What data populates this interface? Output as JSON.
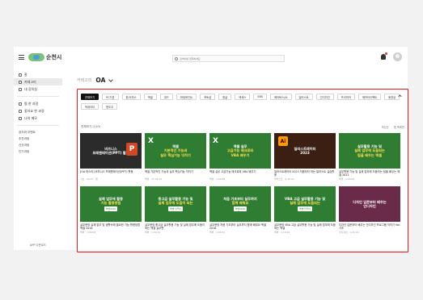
{
  "brand": {
    "logo_text": "순천시"
  },
  "search": {
    "placeholder": "검색어를 입력하세요"
  },
  "sidebar": {
    "items": [
      {
        "label": "홈",
        "active": false
      },
      {
        "label": "카테고리",
        "active": true
      },
      {
        "label": "내 강의실",
        "active": false
      }
    ],
    "items2": [
      {
        "label": "찜 한 과정"
      },
      {
        "label": "좋아요 한 과정"
      },
      {
        "label": "나의 메모"
      }
    ],
    "plain": [
      "공지와 이벤트",
      "추천과정",
      "신규과정",
      "인기과정"
    ],
    "footer": "APP 다운로드"
  },
  "breadcrumb": {
    "label": "카테고리",
    "current": "OA"
  },
  "chips": [
    "전체보기",
    "PC기본",
    "한/오피스",
    "엑셀",
    "워드",
    "파워포인트",
    "포토샵",
    "한글",
    "엑세스",
    "SNS",
    "메타버스/AI",
    "일러스트",
    "인디자인",
    "프리미어",
    "에프터이펙트",
    "동영상",
    "빅데이터",
    "윈도우"
  ],
  "list": {
    "count": "전체보기 (210)",
    "sort_label": "최신순",
    "filter_label": "찜 목록만"
  },
  "cards": [
    {
      "thumb": "pptx",
      "lines": [
        "비즈니스",
        "프레젠테이션(PPT) 활용"
      ],
      "title": "[OA 마스터] 비즈니스 프레젠테이션(PPT) 활용",
      "meta": "기초 · 04:37 · 찜"
    },
    {
      "thumb": "green",
      "lines": [
        "엑셀",
        "기본적인 기능과",
        "실무 핵심기능 익히기"
      ],
      "title": "엑셀 기본적인 기능과 실무 핵심기능 익히기",
      "meta": "엑셀 · 17:36:19"
    },
    {
      "thumb": "green",
      "lines": [
        "엑셀 실무",
        "고급기능 매크로와",
        "VBA 배우기"
      ],
      "title": "엑셀 실무 고급기능 매크로와 VBA 배우기",
      "meta": "엑셀 · 1:00:48"
    },
    {
      "thumb": "illustrator",
      "lines": [
        "일러스트레이터",
        "2023"
      ],
      "title": "일러스트레이터 2023 처음부터 하는 일러스트 실습활용",
      "meta": "일러스트 · 1:10:22"
    },
    {
      "thumb": "green",
      "lines": [
        "실무활용 기능 및",
        "실제 업무에 도움되는",
        "팁을 배우는 엑셀"
      ],
      "title": "실무활용 기능 및 실제 업무에 도움되는 팁을 배우는 엑셀 2021",
      "meta": "엑셀 · 1:40:09"
    },
    {
      "thumb": "green",
      "lines": [
        "실제 업무에 활용",
        "기능 활용방법",
        "엑셀2016"
      ],
      "title": "실무현장 실제 업무 및 생활속에 필요한 기능 활용방법 엑셀 2016",
      "meta": "엑셀 · 1:40:04"
    },
    {
      "thumb": "green",
      "lines": [
        "중고급 실무활용 기능 및",
        "실제 업무에 도움이 되는",
        "엑셀 실무편"
      ],
      "title": "실무현장 중고급 실무활용 기능 및 실제 업무에 도움이 되는 엑셀 실무편",
      "meta": "엑셀 · 1:02:34"
    },
    {
      "thumb": "green",
      "lines": [
        "처음 기초부터 실무까지",
        "함께 배워요",
        "엑셀2016"
      ],
      "title": "실무현장 처음 기초부터 실무까지 함께 배워요 엑셀 2016",
      "meta": "엑셀 · 1:04:51"
    },
    {
      "thumb": "green",
      "lines": [
        "VBA 고급 실무활용 기능 및",
        "실제 업무에 도움되는",
        "엑셀 업무편"
      ],
      "title": "실무현장 VBA 고급 실무활용 기능 및 실제 업무에 도움되는 엑셀",
      "meta": "엑셀 · 1:10:26"
    },
    {
      "thumb": "purple",
      "lines": [
        "디자인 입문부터 배우는",
        "인디자인"
      ],
      "title": "디자인 입문부터 배우는 인디자인 프로그램 익히기 Vol. 기초",
      "meta": "인디자인 · 1:20:14"
    }
  ],
  "colors": {
    "green": "#2f7d32",
    "accent_red": "#e31b1b",
    "purple": "#6a2a4a"
  }
}
